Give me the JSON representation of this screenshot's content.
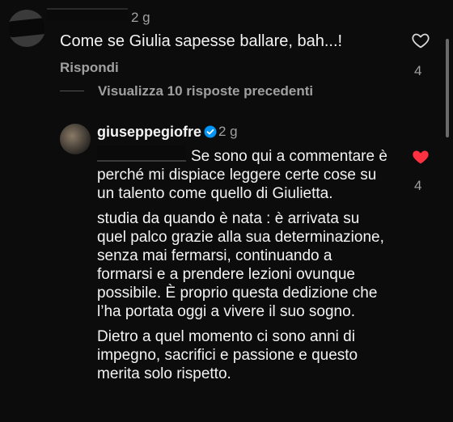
{
  "comment": {
    "time": "2 g",
    "text": "Come se Giulia sapesse ballare, bah...!",
    "reply_label": "Rispondi",
    "like_count": "4"
  },
  "thread": {
    "view_replies": "Visualizza 10 risposte precedenti"
  },
  "reply": {
    "username": "giuseppegiofre",
    "time": "2 g",
    "paragraph1": "Se sono qui a commentare è perché mi dispiace leggere certe cose su un talento come quello di Giulietta.",
    "paragraph2": "studia da quando è nata : è arrivata su quel palco grazie alla sua determinazione, senza mai fermarsi, continuando a formarsi e a prendere lezioni ovunque possibile. È proprio questa dedizione che l’ha portata oggi a vivere il suo sogno.",
    "paragraph3": "Dietro a quel momento ci sono anni di impegno, sacrifici e passione e questo merita solo rispetto.",
    "like_count": "4",
    "liked": true
  },
  "colors": {
    "background": "#0c0c0c",
    "text": "#f3f3f3",
    "muted": "#a0a0a0",
    "like_red": "#ff3040",
    "verified_blue": "#0095f6"
  }
}
